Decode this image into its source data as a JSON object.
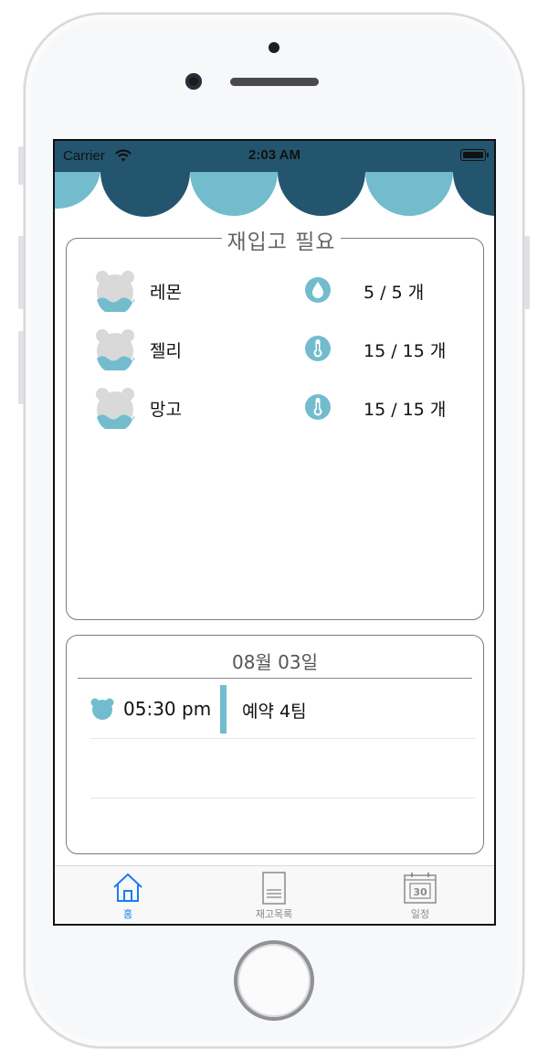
{
  "status_bar": {
    "carrier": "Carrier",
    "time": "2:03 AM"
  },
  "restock": {
    "title": "재입고 필요",
    "items": [
      {
        "name": "레몬",
        "count": "5 / 5 개",
        "status_icon": "drop-icon"
      },
      {
        "name": "젤리",
        "count": "15 / 15 개",
        "status_icon": "thermometer-icon"
      },
      {
        "name": "망고",
        "count": "15 / 15 개",
        "status_icon": "thermometer-icon"
      }
    ]
  },
  "schedule": {
    "date": "08월 03일",
    "entries": [
      {
        "time": "05:30 pm",
        "text": "예약 4팀"
      }
    ]
  },
  "tabs": [
    {
      "label": "홈",
      "icon": "home-icon",
      "selected": true
    },
    {
      "label": "재고목록",
      "icon": "document-icon",
      "selected": false
    },
    {
      "label": "일정",
      "icon": "calendar-icon",
      "selected": false,
      "icon_text": "30"
    }
  ],
  "colors": {
    "header": "#24556f",
    "accent": "#72bcce",
    "tab_active": "#1a7cf2"
  }
}
